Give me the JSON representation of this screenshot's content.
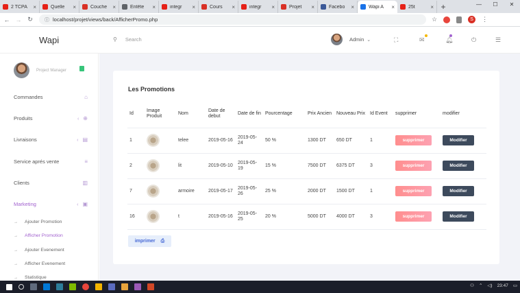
{
  "browser": {
    "tabs": [
      {
        "title": "2 TCPA",
        "color": "#e62117"
      },
      {
        "title": "Quelle",
        "color": "#e62117"
      },
      {
        "title": "Couche",
        "color": "#d93025"
      },
      {
        "title": "Entête",
        "color": "#5f6368"
      },
      {
        "title": "integr",
        "color": "#e62117"
      },
      {
        "title": "Cours",
        "color": "#d93025"
      },
      {
        "title": "integr",
        "color": "#e62117"
      },
      {
        "title": "Projet",
        "color": "#d93025"
      },
      {
        "title": "Facebo",
        "color": "#3b5998"
      },
      {
        "title": "Wapi A",
        "color": "#1a73e8"
      },
      {
        "title": "25t",
        "color": "#e62117"
      }
    ],
    "url": "localhost/projet/views/back/AfficherPromo.php",
    "profile_initial": "S"
  },
  "header": {
    "brand": "Wapi",
    "search_placeholder": "Search",
    "user_name": "Admin"
  },
  "sidebar": {
    "role": "Project Manager",
    "items": [
      {
        "label": "Commandes",
        "icon": "⌂"
      },
      {
        "label": "Produits",
        "icon": "⊕"
      },
      {
        "label": "Livraisons",
        "icon": "▤"
      },
      {
        "label": "Service aprés vente",
        "icon": "≡"
      },
      {
        "label": "Clients",
        "icon": "▥"
      },
      {
        "label": "Marketing",
        "icon": "▣"
      }
    ],
    "subitems": [
      {
        "label": "Ajouter Promotion"
      },
      {
        "label": "Afficher Promotion"
      },
      {
        "label": "Ajouter Evenement"
      },
      {
        "label": "Afficher Evenement"
      },
      {
        "label": "Statistique"
      }
    ]
  },
  "promotions": {
    "title": "Les Promotions",
    "columns": [
      "Id",
      "Image Produit",
      "Nom",
      "Date de debut",
      "Date de fin",
      "Pourcentage",
      "Prix Ancien",
      "Nouveau Prix",
      "Id Event",
      "supprimer",
      "modifier"
    ],
    "delete_label": "supprimer",
    "edit_label": "Modifier",
    "rows": [
      {
        "id": "1",
        "nom": "telee",
        "debut": "2019-05-16",
        "fin": "2019-05-24",
        "pct": "50 %",
        "ancien": "1300 DT",
        "nouveau": "650 DT",
        "event": "1"
      },
      {
        "id": "2",
        "nom": "lit",
        "debut": "2019-05-10",
        "fin": "2019-05-19",
        "pct": "15 %",
        "ancien": "7500 DT",
        "nouveau": "6375 DT",
        "event": "3"
      },
      {
        "id": "7",
        "nom": "armoire",
        "debut": "2019-05-17",
        "fin": "2019-05-26",
        "pct": "25 %",
        "ancien": "2000 DT",
        "nouveau": "1500 DT",
        "event": "1"
      },
      {
        "id": "16",
        "nom": "t",
        "debut": "2019-05-16",
        "fin": "2019-05-25",
        "pct": "20 %",
        "ancien": "5000 DT",
        "nouveau": "4000 DT",
        "event": "3"
      }
    ],
    "print_label": "imprimer"
  },
  "taskbar": {
    "time": "23:47"
  }
}
